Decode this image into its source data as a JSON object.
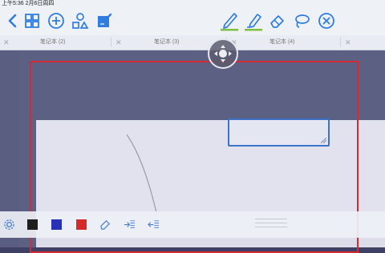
{
  "status_bar": {
    "time_text": "上午5:36  2月6日周四"
  },
  "toolbar": {
    "left_icons": [
      "chevron-left-icon",
      "grid-icon",
      "plus-circle-icon",
      "shapes-icon",
      "edit-note-icon"
    ],
    "right_icons": [
      "pen-icon",
      "highlighter-icon",
      "eraser-icon",
      "lasso-icon",
      "close-circle-icon"
    ],
    "accent_color": "#2f7de1",
    "pen_underline_color": "#7fbf3f"
  },
  "tabs": [
    {
      "label": "笔记本 (2)"
    },
    {
      "label": "笔记本 (3)"
    },
    {
      "label": "笔记本 (4)"
    }
  ],
  "palette": {
    "colors": [
      "#1e1e1e",
      "#2832b4",
      "#d42a2a"
    ],
    "icons": [
      "settings-icon",
      "eraser-icon",
      "indent-icon",
      "outdent-icon"
    ]
  },
  "canvas": {
    "frame_color": "#d42a36",
    "textbox_border_color": "#3d73c9"
  }
}
